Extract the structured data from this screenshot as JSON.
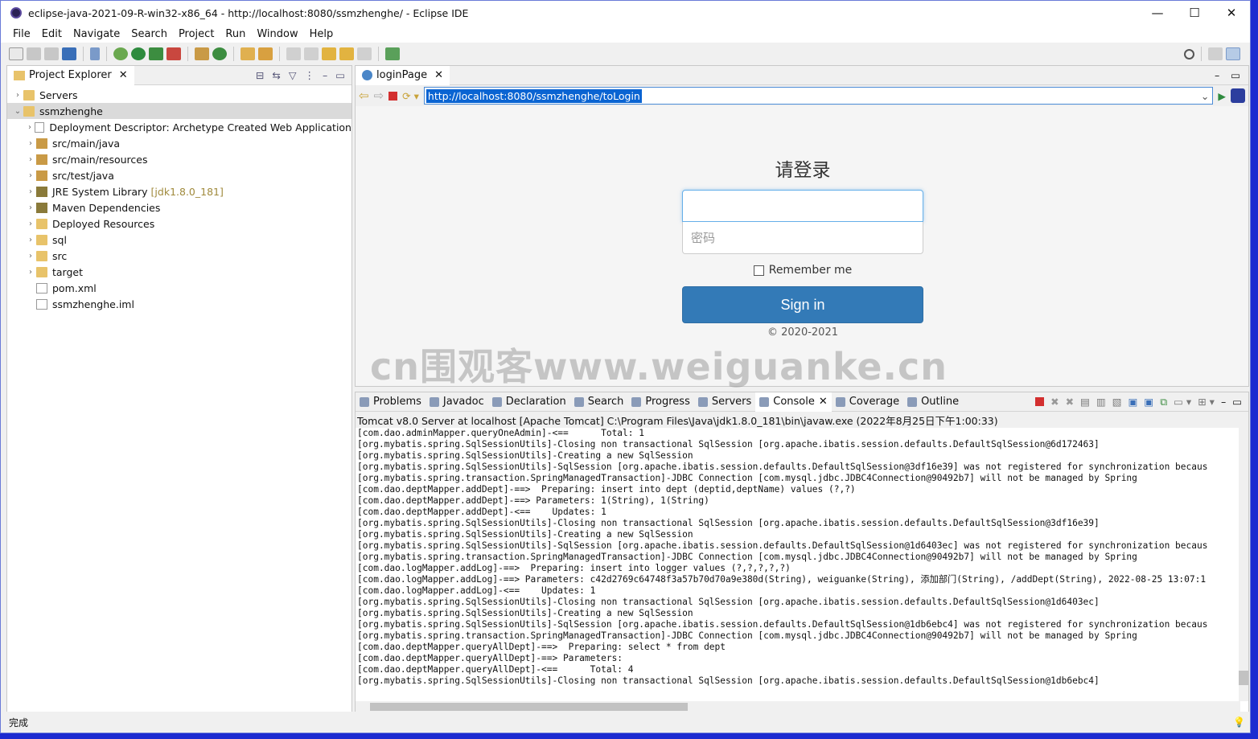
{
  "window": {
    "title": "eclipse-java-2021-09-R-win32-x86_64 - http://localhost:8080/ssmzhenghe/ - Eclipse IDE",
    "controls": [
      "—",
      "☐",
      "✕"
    ]
  },
  "menu": [
    "File",
    "Edit",
    "Navigate",
    "Search",
    "Project",
    "Run",
    "Window",
    "Help"
  ],
  "explorer": {
    "tab_label": "Project Explorer",
    "items": [
      {
        "label": "Servers",
        "deco": "",
        "indent": 0,
        "open": false,
        "icon": "folder"
      },
      {
        "label": "ssmzhenghe",
        "deco": "",
        "indent": 0,
        "open": true,
        "icon": "project"
      },
      {
        "label": "Deployment Descriptor: Archetype Created Web Application",
        "deco": "",
        "indent": 1,
        "open": false,
        "icon": "file"
      },
      {
        "label": "src/main/java",
        "deco": "",
        "indent": 1,
        "open": false,
        "icon": "pkg"
      },
      {
        "label": "src/main/resources",
        "deco": "",
        "indent": 1,
        "open": false,
        "icon": "pkg"
      },
      {
        "label": "src/test/java",
        "deco": "",
        "indent": 1,
        "open": false,
        "icon": "pkg"
      },
      {
        "label": "JRE System Library",
        "deco": "[jdk1.8.0_181]",
        "indent": 1,
        "open": false,
        "icon": "lib"
      },
      {
        "label": "Maven Dependencies",
        "deco": "",
        "indent": 1,
        "open": false,
        "icon": "lib"
      },
      {
        "label": "Deployed Resources",
        "deco": "",
        "indent": 1,
        "open": false,
        "icon": "folder"
      },
      {
        "label": "sql",
        "deco": "",
        "indent": 1,
        "open": false,
        "icon": "folder"
      },
      {
        "label": "src",
        "deco": "",
        "indent": 1,
        "open": false,
        "icon": "folder"
      },
      {
        "label": "target",
        "deco": "",
        "indent": 1,
        "open": false,
        "icon": "folder"
      },
      {
        "label": "pom.xml",
        "deco": "",
        "indent": 1,
        "open": null,
        "icon": "file"
      },
      {
        "label": "ssmzhenghe.iml",
        "deco": "",
        "indent": 1,
        "open": null,
        "icon": "file"
      }
    ]
  },
  "browser": {
    "tab_label": "loginPage",
    "url": "http://localhost:8080/ssmzhenghe/toLogin",
    "heading": "请登录",
    "username_placeholder": "",
    "password_placeholder": "密码",
    "remember_label": "Remember me",
    "signin_label": "Sign in",
    "copyright": "© 2020-2021",
    "watermark": "cn围观客www.weiguanke.cn"
  },
  "bottom_tabs": [
    "Problems",
    "Javadoc",
    "Declaration",
    "Search",
    "Progress",
    "Servers",
    "Console",
    "Coverage",
    "Outline"
  ],
  "console": {
    "header": "Tomcat v8.0 Server at localhost [Apache Tomcat] C:\\Program Files\\Java\\jdk1.8.0_181\\bin\\javaw.exe  (2022年8月25日下午1:00:33)",
    "lines": [
      "[com.dao.adminMapper.queryOneAdmin]-<==      Total: 1",
      "[org.mybatis.spring.SqlSessionUtils]-Closing non transactional SqlSession [org.apache.ibatis.session.defaults.DefaultSqlSession@6d172463]",
      "[org.mybatis.spring.SqlSessionUtils]-Creating a new SqlSession",
      "[org.mybatis.spring.SqlSessionUtils]-SqlSession [org.apache.ibatis.session.defaults.DefaultSqlSession@3df16e39] was not registered for synchronization becaus",
      "[org.mybatis.spring.transaction.SpringManagedTransaction]-JDBC Connection [com.mysql.jdbc.JDBC4Connection@90492b7] will not be managed by Spring",
      "[com.dao.deptMapper.addDept]-==>  Preparing: insert into dept (deptid,deptName) values (?,?)",
      "[com.dao.deptMapper.addDept]-==> Parameters: 1(String), 1(String)",
      "[com.dao.deptMapper.addDept]-<==    Updates: 1",
      "[org.mybatis.spring.SqlSessionUtils]-Closing non transactional SqlSession [org.apache.ibatis.session.defaults.DefaultSqlSession@3df16e39]",
      "[org.mybatis.spring.SqlSessionUtils]-Creating a new SqlSession",
      "[org.mybatis.spring.SqlSessionUtils]-SqlSession [org.apache.ibatis.session.defaults.DefaultSqlSession@1d6403ec] was not registered for synchronization becaus",
      "[org.mybatis.spring.transaction.SpringManagedTransaction]-JDBC Connection [com.mysql.jdbc.JDBC4Connection@90492b7] will not be managed by Spring",
      "[com.dao.logMapper.addLog]-==>  Preparing: insert into logger values (?,?,?,?,?)",
      "[com.dao.logMapper.addLog]-==> Parameters: c42d2769c64748f3a57b70d70a9e380d(String), weiguanke(String), 添加部门(String), /addDept(String), 2022-08-25 13:07:1",
      "[com.dao.logMapper.addLog]-<==    Updates: 1",
      "[org.mybatis.spring.SqlSessionUtils]-Closing non transactional SqlSession [org.apache.ibatis.session.defaults.DefaultSqlSession@1d6403ec]",
      "[org.mybatis.spring.SqlSessionUtils]-Creating a new SqlSession",
      "[org.mybatis.spring.SqlSessionUtils]-SqlSession [org.apache.ibatis.session.defaults.DefaultSqlSession@1db6ebc4] was not registered for synchronization becaus",
      "[org.mybatis.spring.transaction.SpringManagedTransaction]-JDBC Connection [com.mysql.jdbc.JDBC4Connection@90492b7] will not be managed by Spring",
      "[com.dao.deptMapper.queryAllDept]-==>  Preparing: select * from dept",
      "[com.dao.deptMapper.queryAllDept]-==> Parameters: ",
      "[com.dao.deptMapper.queryAllDept]-<==      Total: 4",
      "[org.mybatis.spring.SqlSessionUtils]-Closing non transactional SqlSession [org.apache.ibatis.session.defaults.DefaultSqlSession@1db6ebc4]"
    ]
  },
  "status_text": "完成",
  "colors": {
    "accent": "#337ab7",
    "url_selection": "#0a64d2",
    "desktop": "#1d2bd0"
  }
}
